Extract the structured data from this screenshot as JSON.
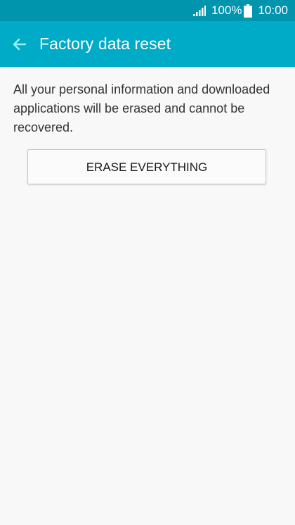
{
  "status_bar": {
    "battery_percent": "100%",
    "time": "10:00",
    "icons": [
      "signal-icon",
      "battery-icon"
    ]
  },
  "app_bar": {
    "title": "Factory data reset",
    "back_icon": "back-arrow-icon"
  },
  "content": {
    "description": "All your personal information and downloaded applications will be erased and cannot be recovered.",
    "erase_button_label": "ERASE EVERYTHING"
  },
  "colors": {
    "status_bar": "#0094ad",
    "app_bar": "#00abc7",
    "background": "#f8f8f8",
    "back_arrow": "#9af0ff"
  }
}
